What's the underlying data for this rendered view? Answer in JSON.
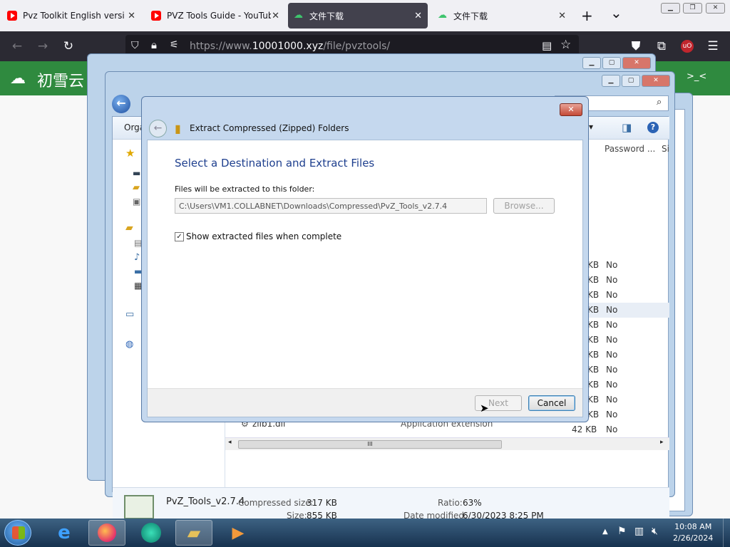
{
  "browser": {
    "tabs": [
      {
        "title": "Pvz Toolkit English version",
        "icon": "youtube-icon"
      },
      {
        "title": "PVZ Tools Guide - YouTube",
        "icon": "youtube-icon"
      },
      {
        "title": "文件下载",
        "icon": "cloud-icon"
      },
      {
        "title": "文件下载",
        "icon": "cloud-icon"
      }
    ],
    "new_tab": "+",
    "tab_list": "⌄",
    "url_prefix": "https://www.",
    "url_host": "10001000.xyz",
    "url_path": "/file/pvztools/"
  },
  "page": {
    "brand": "初雪云",
    "right_note": ">_<"
  },
  "explorer": {
    "organize": "Orga",
    "search_hint": "#",
    "column_password": "Password ...",
    "column_size": "Si",
    "rows": [
      {
        "size": "KB",
        "protected": "No"
      },
      {
        "size": "KB",
        "protected": "No"
      },
      {
        "size": "KB",
        "protected": "No"
      },
      {
        "size": "KB",
        "protected": "No"
      },
      {
        "size": "KB",
        "protected": "No"
      },
      {
        "size": "KB",
        "protected": "No"
      },
      {
        "size": "KB",
        "protected": "No"
      },
      {
        "size": "KB",
        "protected": "No"
      },
      {
        "size": "KB",
        "protected": "No"
      },
      {
        "size": "KB",
        "protected": "No"
      },
      {
        "size": "KB",
        "protected": "No"
      },
      {
        "size": "42 KB",
        "protected": "No"
      }
    ],
    "last_row_name": "zlib1.dll",
    "last_row_type": "Application extension",
    "scroll_grip": "III",
    "details": {
      "name": "PvZ_Tools_v2.7.4",
      "compressed_label": "Compressed size:",
      "compressed_value": "317 KB",
      "size_label": "Size:",
      "size_value": "855 KB",
      "ratio_label": "Ratio:",
      "ratio_value": "63%",
      "modified_label": "Date modified:",
      "modified_value": "6/30/2023 8:25 PM"
    }
  },
  "dialog": {
    "title": "Extract Compressed (Zipped) Folders",
    "heading": "Select a Destination and Extract Files",
    "folder_label": "Files will be extracted to this folder:",
    "folder_path": "C:\\Users\\VM1.COLLABNET\\Downloads\\Compressed\\PvZ_Tools_v2.7.4",
    "browse": "Browse...",
    "show_files": "Show extracted files when complete",
    "next": "Next",
    "cancel": "Cancel"
  },
  "taskbar": {
    "time": "10:08 AM",
    "date": "2/26/2024"
  }
}
